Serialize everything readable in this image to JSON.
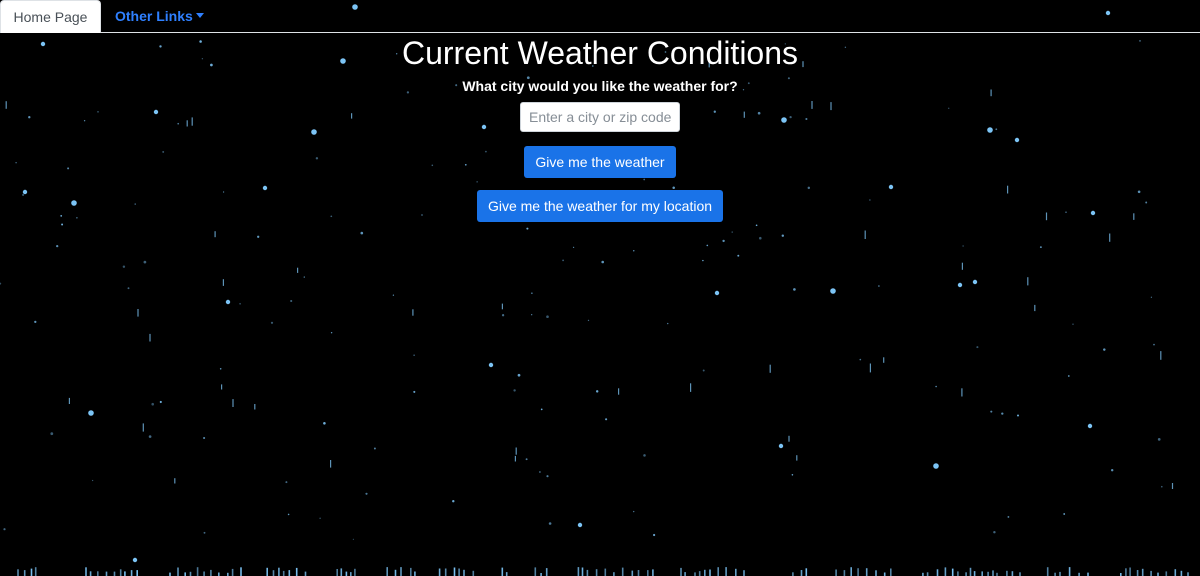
{
  "nav": {
    "home_label": "Home Page",
    "other_links_label": "Other Links"
  },
  "main": {
    "title": "Current Weather Conditions",
    "prompt": "What city would you like the weather for?",
    "city_input": {
      "value": "",
      "placeholder": "Enter a city or zip code"
    },
    "weather_button_label": "Give me the weather",
    "location_button_label": "Give me the weather for my location"
  },
  "colors": {
    "background": "#000000",
    "accent": "#1a73e8",
    "link": "#2f80ff",
    "raindrop": "#7cc4f5"
  },
  "icons": {
    "dropdown": "caret-down-icon"
  }
}
